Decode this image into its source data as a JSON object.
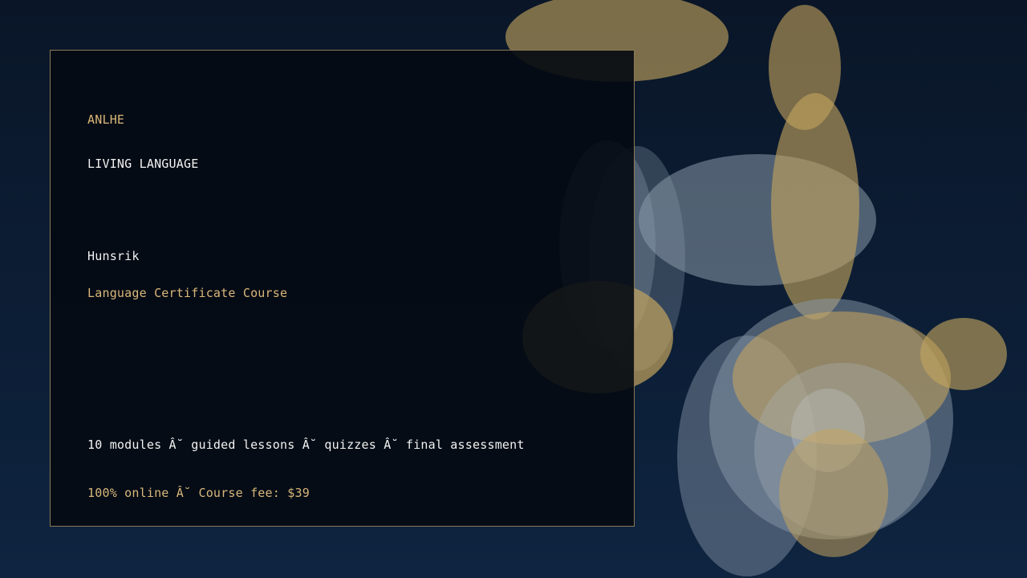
{
  "card": {
    "brand": "ANLHE",
    "tagline": "LIVING LANGUAGE",
    "language": "Hunsrik",
    "course_type": "Language Certificate Course",
    "details": "10 modules Â˘ guided lessons Â˘ quizzes Â˘ final assessment",
    "fee_line": "100% online Â˘ Course fee: $39"
  },
  "colors": {
    "background_top": "#0a1628",
    "background_bottom": "#0e2440",
    "accent_gold": "#d9b77a",
    "bubble_gold": "#c4a45e",
    "bubble_slate": "#8a9aaa",
    "text_white": "#f2f2f2"
  }
}
